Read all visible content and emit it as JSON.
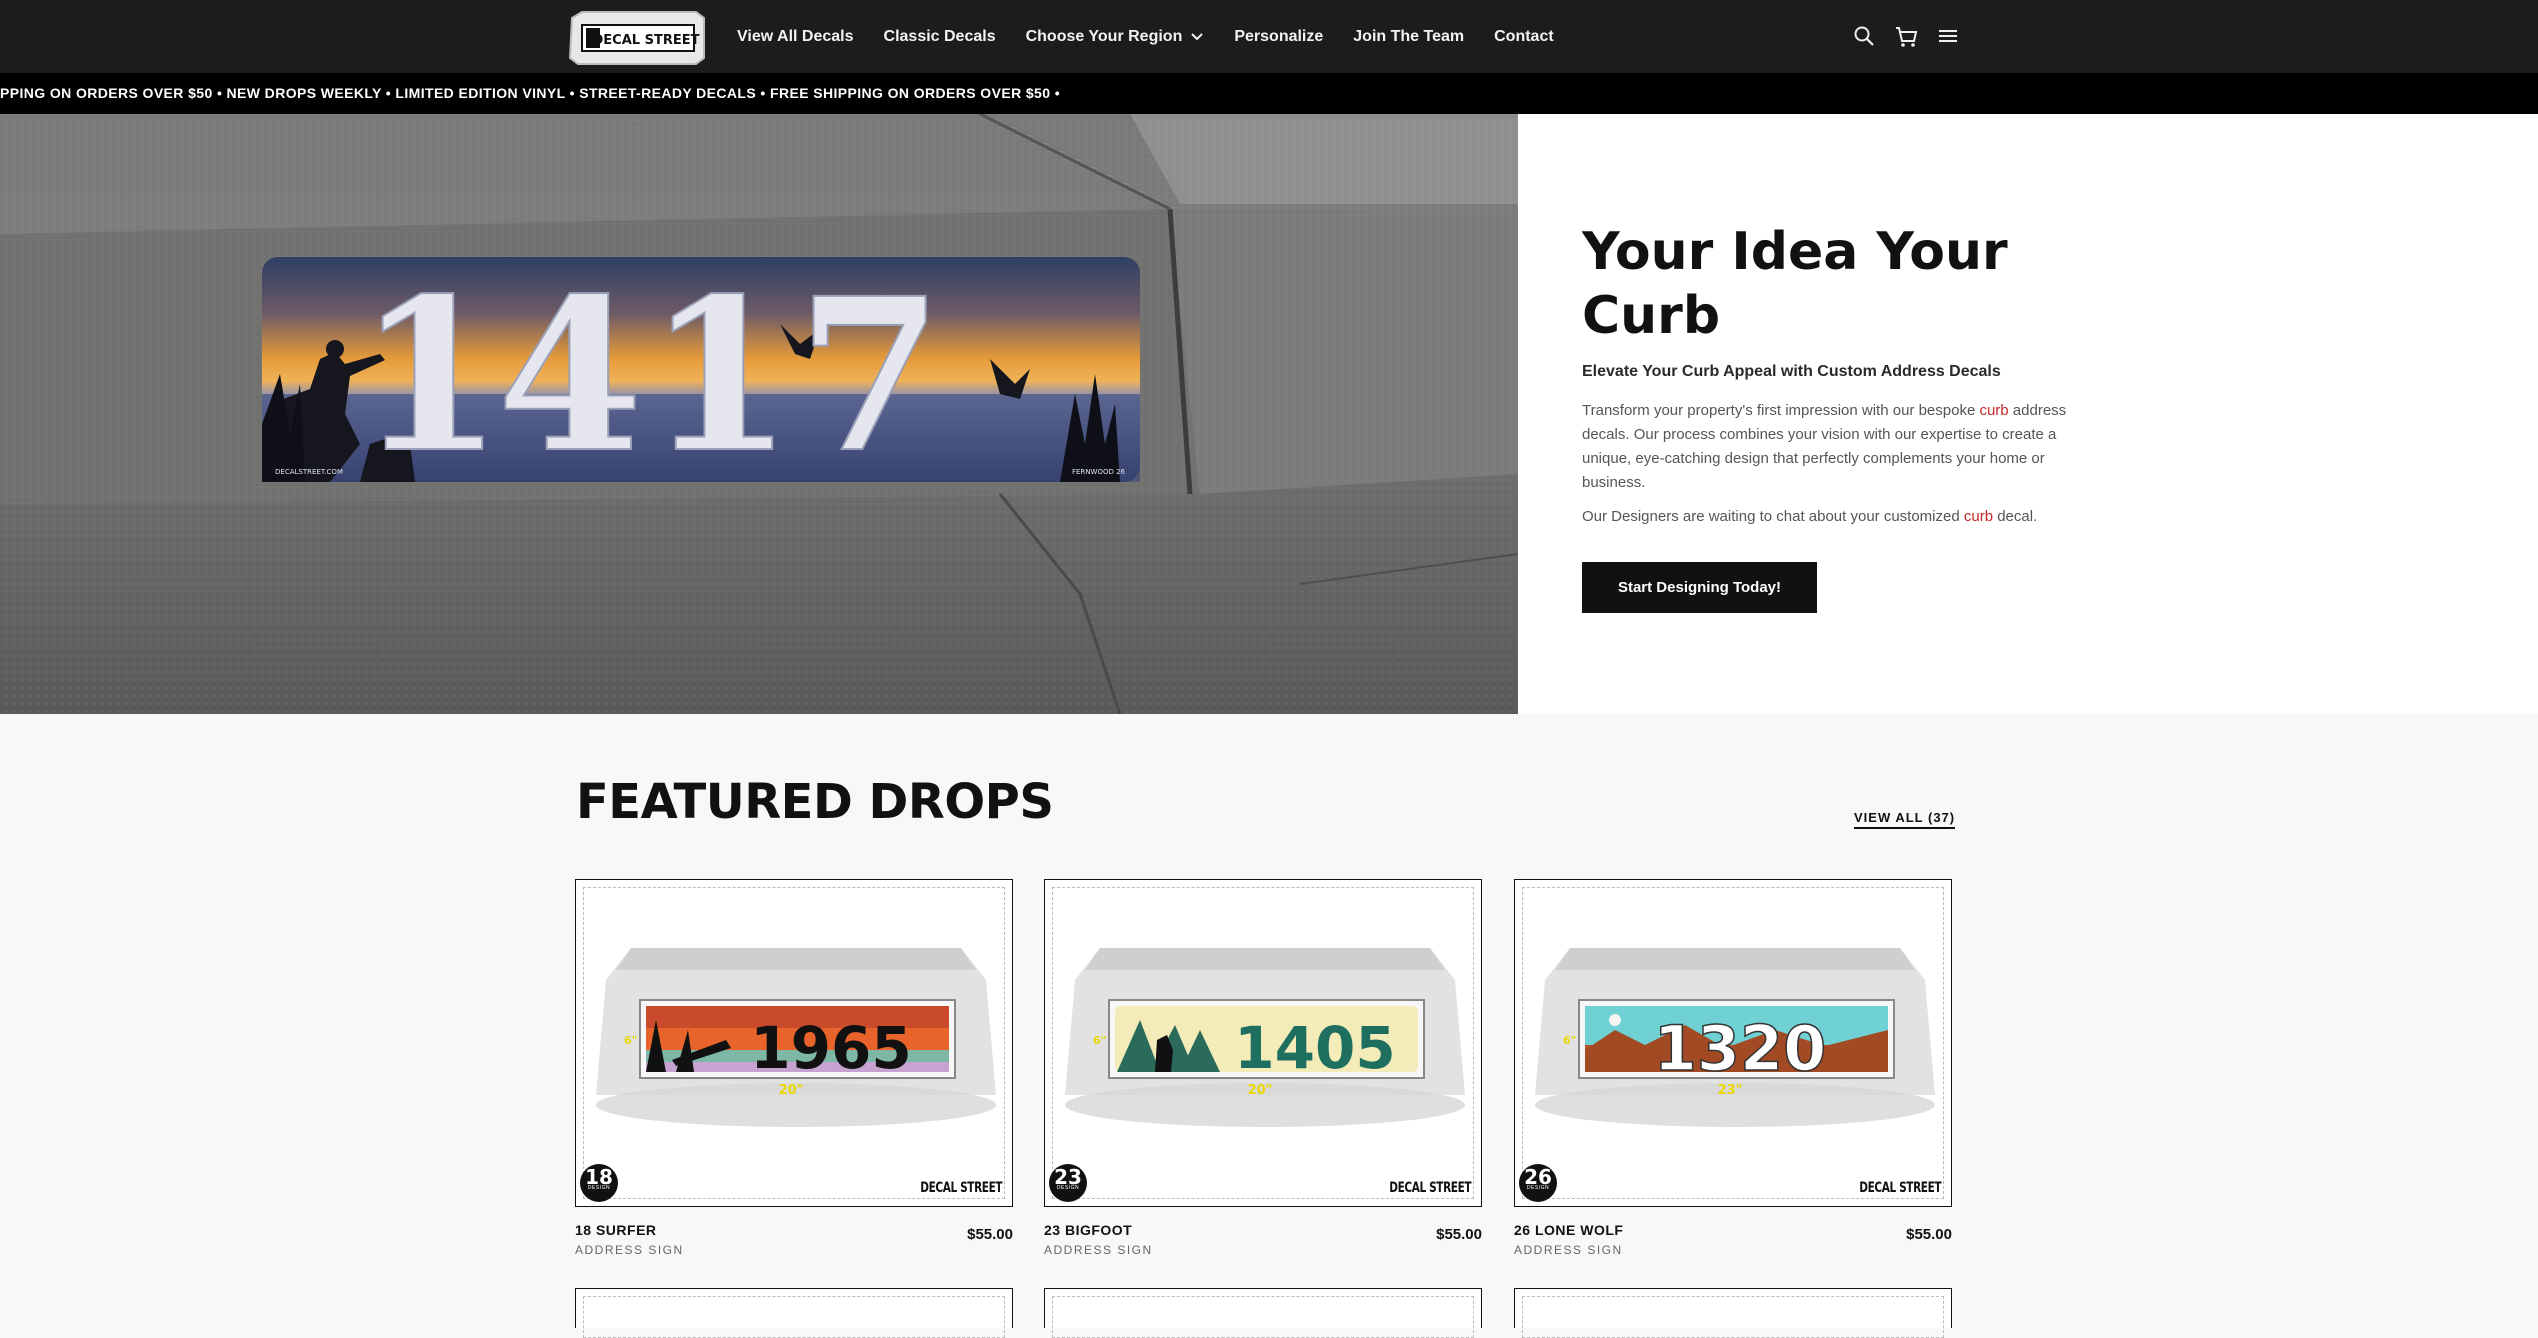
{
  "nav": {
    "logo_text": "DECAL STREET",
    "links": [
      {
        "label": "View All Decals"
      },
      {
        "label": "Classic Decals"
      },
      {
        "label": "Choose Your Region"
      },
      {
        "label": "Personalize"
      },
      {
        "label": "Join The Team"
      },
      {
        "label": "Contact"
      }
    ],
    "icons": [
      "search-icon",
      "cart-icon",
      "menu-icon"
    ]
  },
  "ticker": "PPING ON ORDERS OVER $50 • NEW DROPS WEEKLY • LIMITED EDITION VINYL • STREET-READY DECALS • FREE SHIPPING ON ORDERS OVER $50 •",
  "hero": {
    "decal_number": "1417",
    "decal_left_caption": "DECALSTREET.COM",
    "decal_right_caption": "FERNWOOD 26",
    "title": "Your Idea Your Curb",
    "subtitle": "Elevate Your Curb Appeal with Custom Address Decals",
    "p1_before": "Transform your property's first impression with our bespoke ",
    "p1_link": "curb",
    "p1_after": " address decals. Our process combines your vision with our expertise to create a unique, eye-catching design that perfectly complements your home or business.",
    "p2_before": "Our Designers are waiting to chat about your customized ",
    "p2_link": "curb",
    "p2_after": " decal.",
    "cta": "Start Designing Today!"
  },
  "featured": {
    "title": "FEATURED DROPS",
    "view_all": "VIEW ALL (37)",
    "products": [
      {
        "badge": "18",
        "badge_label": "DESIGN",
        "number": "1965",
        "width_label": "20\"",
        "height_label": "6\"",
        "name": "18 SURFER",
        "type": "ADDRESS SIGN",
        "price": "$55.00",
        "brand": "DECAL STREET"
      },
      {
        "badge": "23",
        "badge_label": "DESIGN",
        "number": "1405",
        "width_label": "20\"",
        "height_label": "6\"",
        "name": "23 BIGFOOT",
        "type": "ADDRESS SIGN",
        "price": "$55.00",
        "brand": "DECAL STREET"
      },
      {
        "badge": "26",
        "badge_label": "DESIGN",
        "number": "1320",
        "width_label": "23\"",
        "height_label": "6\"",
        "name": "26 LONE WOLF",
        "type": "ADDRESS SIGN",
        "price": "$55.00",
        "brand": "DECAL STREET"
      }
    ]
  },
  "colors": {
    "nav_bg": "#1c1c1c",
    "accent_link": "#c62828",
    "button_bg": "#111111",
    "dimension_yellow": "#e8d800"
  }
}
